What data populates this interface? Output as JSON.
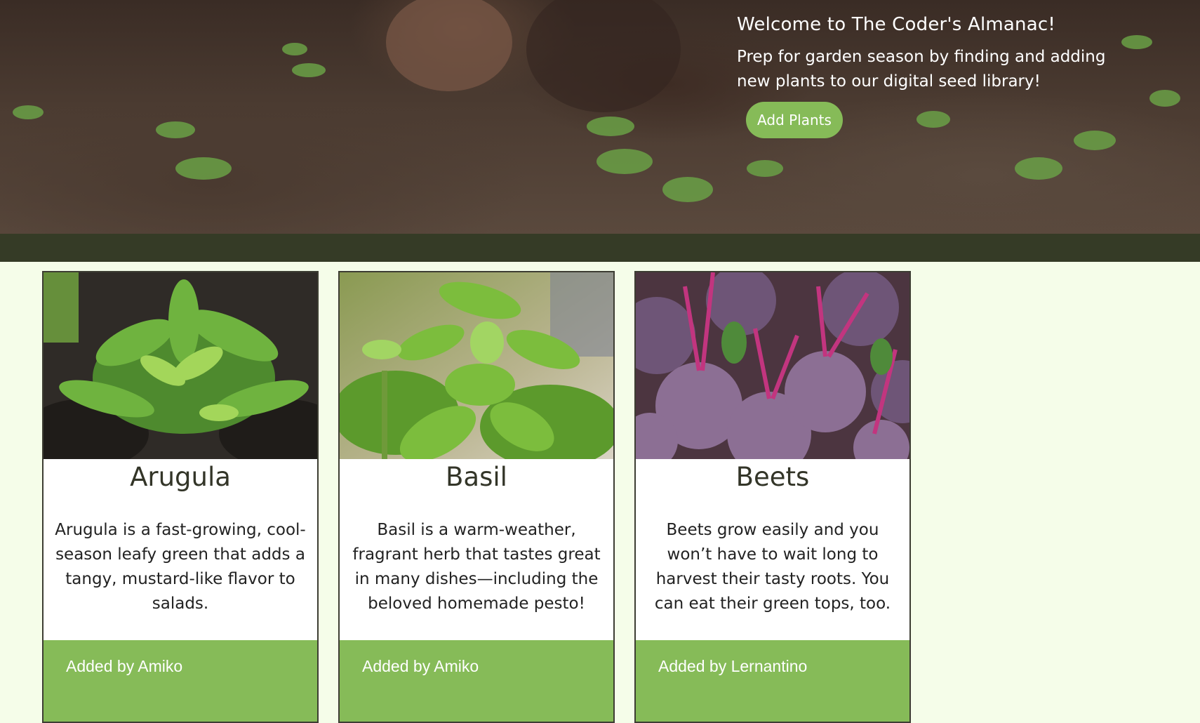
{
  "hero": {
    "title": "Welcome to The Coder's Almanac!",
    "subtitle": "Prep for garden season by finding and adding new plants to our digital seed library!",
    "button_label": "Add Plants"
  },
  "plants": [
    {
      "name": "Arugula",
      "description": "Arugula is a fast-growing, cool-season leafy green that adds a tangy, mustard-like flavor to salads.",
      "added_by": "Added by Amiko",
      "image_icon": "arugula-photo"
    },
    {
      "name": "Basil",
      "description": "Basil is a warm-weather, fragrant herb that tastes great in many dishes—including the beloved homemade pesto!",
      "added_by": "Added by Amiko",
      "image_icon": "basil-photo"
    },
    {
      "name": "Beets",
      "description": "Beets grow easily and you won’t have to wait long to harvest their tasty roots. You can eat their green tops, too.",
      "added_by": "Added by Lernantino",
      "image_icon": "beets-photo"
    }
  ],
  "colors": {
    "accent_green": "#86bb58",
    "dark_bar": "#353b26",
    "page_background": "#f5fde9"
  }
}
